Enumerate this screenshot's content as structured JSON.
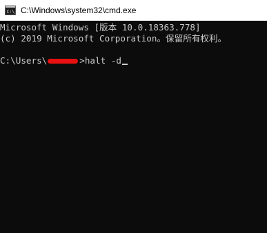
{
  "window": {
    "title": "C:\\Windows\\system32\\cmd.exe",
    "icon": "cmd-console-icon"
  },
  "console": {
    "header_line_1": "Microsoft Windows [版本 10.0.18363.778]",
    "header_line_2": "(c) 2019 Microsoft Corporation。保留所有权利。",
    "prompt_prefix": "C:\\Users\\",
    "prompt_suffix": ">",
    "command": "halt -d"
  },
  "colors": {
    "console_background": "#0c0c0c",
    "console_text": "#cccccc",
    "redaction_mark": "#e81010"
  }
}
